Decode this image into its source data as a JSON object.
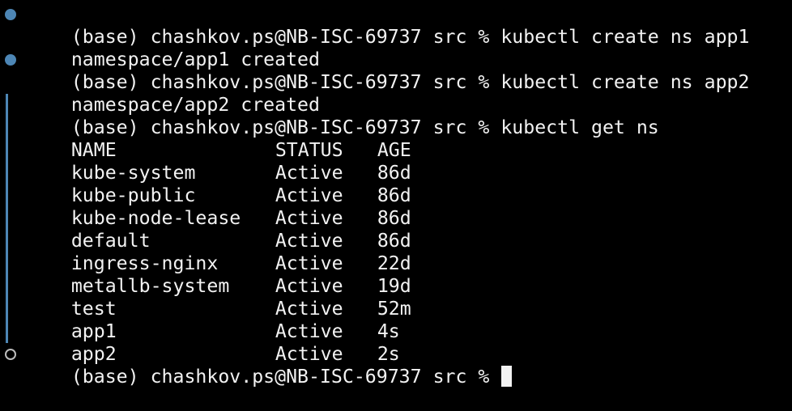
{
  "colors": {
    "background": "#000000",
    "text": "#f2f2f2",
    "prompt_marker": "#4d86b5"
  },
  "lines": [
    {
      "marker": "filled",
      "text": "(base) chashkov.ps@NB-ISC-69737 src % kubectl create ns app1"
    },
    {
      "marker": "none",
      "text": "namespace/app1 created"
    },
    {
      "marker": "filled",
      "text": "(base) chashkov.ps@NB-ISC-69737 src % kubectl create ns app2"
    },
    {
      "marker": "none",
      "text": "namespace/app2 created"
    },
    {
      "marker": "bar",
      "text": "(base) chashkov.ps@NB-ISC-69737 src % kubectl get ns"
    }
  ],
  "table": {
    "headers": [
      "NAME",
      "STATUS",
      "AGE"
    ],
    "rows": [
      [
        "kube-system",
        "Active",
        "86d"
      ],
      [
        "kube-public",
        "Active",
        "86d"
      ],
      [
        "kube-node-lease",
        "Active",
        "86d"
      ],
      [
        "default",
        "Active",
        "86d"
      ],
      [
        "ingress-nginx",
        "Active",
        "22d"
      ],
      [
        "metallb-system",
        "Active",
        "19d"
      ],
      [
        "test",
        "Active",
        "52m"
      ],
      [
        "app1",
        "Active",
        "4s"
      ],
      [
        "app2",
        "Active",
        "2s"
      ]
    ]
  },
  "current_prompt": {
    "marker": "hollow",
    "text": "(base) chashkov.ps@NB-ISC-69737 src % "
  }
}
